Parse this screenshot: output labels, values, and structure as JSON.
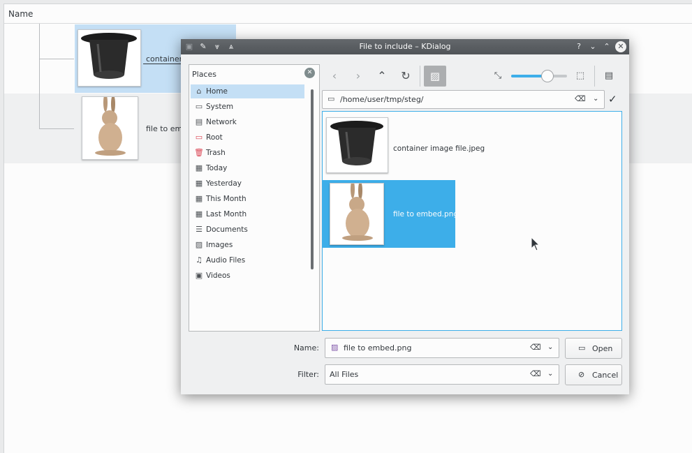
{
  "background": {
    "header_label": "Name",
    "rows": [
      {
        "label": "container"
      },
      {
        "label": "file to emb"
      }
    ]
  },
  "dialog": {
    "title": "File to include – KDialog",
    "titlebar_buttons": [
      "?",
      "⌄",
      "⌃",
      "✕"
    ],
    "places": {
      "title": "Places",
      "items": [
        {
          "label": "Home",
          "icon": "home-icon",
          "glyph": "⌂",
          "selected": true
        },
        {
          "label": "System",
          "icon": "folder-icon",
          "glyph": "▭"
        },
        {
          "label": "Network",
          "icon": "network-icon",
          "glyph": "▤"
        },
        {
          "label": "Root",
          "icon": "folder-red-icon",
          "glyph": "▭"
        },
        {
          "label": "Trash",
          "icon": "trash-icon",
          "glyph": "🗑"
        },
        {
          "label": "Today",
          "icon": "calendar-icon",
          "glyph": "▦"
        },
        {
          "label": "Yesterday",
          "icon": "calendar-icon",
          "glyph": "▦"
        },
        {
          "label": "This Month",
          "icon": "calendar-icon",
          "glyph": "▦"
        },
        {
          "label": "Last Month",
          "icon": "calendar-icon",
          "glyph": "▦"
        },
        {
          "label": "Documents",
          "icon": "documents-icon",
          "glyph": "☰"
        },
        {
          "label": "Images",
          "icon": "images-icon",
          "glyph": "▨"
        },
        {
          "label": "Audio Files",
          "icon": "music-icon",
          "glyph": "♫"
        },
        {
          "label": "Videos",
          "icon": "video-icon",
          "glyph": "▣"
        }
      ]
    },
    "location": {
      "path": "/home/user/tmp/steg/"
    },
    "files": [
      {
        "name": "container image file.jpeg",
        "selected": false
      },
      {
        "name": "file to embed.png",
        "selected": true
      }
    ],
    "zoom_level": 0.65,
    "name_field": {
      "label": "Name:",
      "value": "file to embed.png"
    },
    "filter_field": {
      "label": "Filter:",
      "value": "All Files"
    },
    "open_button": "Open",
    "cancel_button": "Cancel",
    "colors": {
      "accent": "#3daee9",
      "selection_light": "#c4dff5"
    }
  }
}
